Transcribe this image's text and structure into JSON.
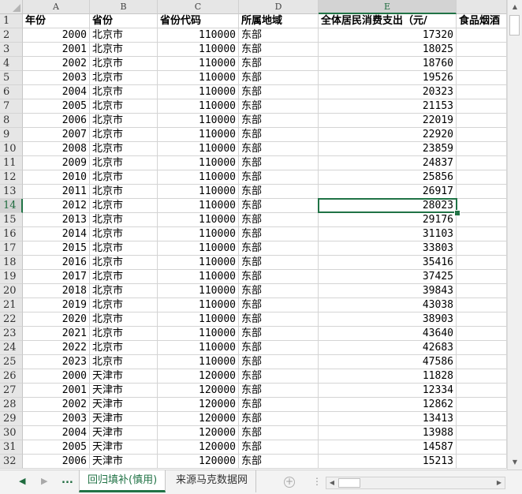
{
  "columns": [
    "A",
    "B",
    "C",
    "D",
    "E"
  ],
  "selected_column": "E",
  "selected_row": 14,
  "header_row": [
    "年份",
    "省份",
    "省份代码",
    "所属地域",
    "全体居民消费支出（元/",
    "食品烟酒"
  ],
  "rows": [
    {
      "n": "2",
      "year": "2000",
      "prov": "北京市",
      "code": "110000",
      "region": "东部",
      "value": "17320"
    },
    {
      "n": "3",
      "year": "2001",
      "prov": "北京市",
      "code": "110000",
      "region": "东部",
      "value": "18025"
    },
    {
      "n": "4",
      "year": "2002",
      "prov": "北京市",
      "code": "110000",
      "region": "东部",
      "value": "18760"
    },
    {
      "n": "5",
      "year": "2003",
      "prov": "北京市",
      "code": "110000",
      "region": "东部",
      "value": "19526"
    },
    {
      "n": "6",
      "year": "2004",
      "prov": "北京市",
      "code": "110000",
      "region": "东部",
      "value": "20323"
    },
    {
      "n": "7",
      "year": "2005",
      "prov": "北京市",
      "code": "110000",
      "region": "东部",
      "value": "21153"
    },
    {
      "n": "8",
      "year": "2006",
      "prov": "北京市",
      "code": "110000",
      "region": "东部",
      "value": "22019"
    },
    {
      "n": "9",
      "year": "2007",
      "prov": "北京市",
      "code": "110000",
      "region": "东部",
      "value": "22920"
    },
    {
      "n": "10",
      "year": "2008",
      "prov": "北京市",
      "code": "110000",
      "region": "东部",
      "value": "23859"
    },
    {
      "n": "11",
      "year": "2009",
      "prov": "北京市",
      "code": "110000",
      "region": "东部",
      "value": "24837"
    },
    {
      "n": "12",
      "year": "2010",
      "prov": "北京市",
      "code": "110000",
      "region": "东部",
      "value": "25856"
    },
    {
      "n": "13",
      "year": "2011",
      "prov": "北京市",
      "code": "110000",
      "region": "东部",
      "value": "26917"
    },
    {
      "n": "14",
      "year": "2012",
      "prov": "北京市",
      "code": "110000",
      "region": "东部",
      "value": "28023"
    },
    {
      "n": "15",
      "year": "2013",
      "prov": "北京市",
      "code": "110000",
      "region": "东部",
      "value": "29176"
    },
    {
      "n": "16",
      "year": "2014",
      "prov": "北京市",
      "code": "110000",
      "region": "东部",
      "value": "31103"
    },
    {
      "n": "17",
      "year": "2015",
      "prov": "北京市",
      "code": "110000",
      "region": "东部",
      "value": "33803"
    },
    {
      "n": "18",
      "year": "2016",
      "prov": "北京市",
      "code": "110000",
      "region": "东部",
      "value": "35416"
    },
    {
      "n": "19",
      "year": "2017",
      "prov": "北京市",
      "code": "110000",
      "region": "东部",
      "value": "37425"
    },
    {
      "n": "20",
      "year": "2018",
      "prov": "北京市",
      "code": "110000",
      "region": "东部",
      "value": "39843"
    },
    {
      "n": "21",
      "year": "2019",
      "prov": "北京市",
      "code": "110000",
      "region": "东部",
      "value": "43038"
    },
    {
      "n": "22",
      "year": "2020",
      "prov": "北京市",
      "code": "110000",
      "region": "东部",
      "value": "38903"
    },
    {
      "n": "23",
      "year": "2021",
      "prov": "北京市",
      "code": "110000",
      "region": "东部",
      "value": "43640"
    },
    {
      "n": "24",
      "year": "2022",
      "prov": "北京市",
      "code": "110000",
      "region": "东部",
      "value": "42683"
    },
    {
      "n": "25",
      "year": "2023",
      "prov": "北京市",
      "code": "110000",
      "region": "东部",
      "value": "47586"
    },
    {
      "n": "26",
      "year": "2000",
      "prov": "天津市",
      "code": "120000",
      "region": "东部",
      "value": "11828"
    },
    {
      "n": "27",
      "year": "2001",
      "prov": "天津市",
      "code": "120000",
      "region": "东部",
      "value": "12334"
    },
    {
      "n": "28",
      "year": "2002",
      "prov": "天津市",
      "code": "120000",
      "region": "东部",
      "value": "12862"
    },
    {
      "n": "29",
      "year": "2003",
      "prov": "天津市",
      "code": "120000",
      "region": "东部",
      "value": "13413"
    },
    {
      "n": "30",
      "year": "2004",
      "prov": "天津市",
      "code": "120000",
      "region": "东部",
      "value": "13988"
    },
    {
      "n": "31",
      "year": "2005",
      "prov": "天津市",
      "code": "120000",
      "region": "东部",
      "value": "14587"
    },
    {
      "n": "32",
      "year": "2006",
      "prov": "天津市",
      "code": "120000",
      "region": "东部",
      "value": "15213"
    }
  ],
  "sheet_tabs": {
    "ellipsis": "...",
    "active": "回归填补(慎用)",
    "other": "来源马克数据网"
  },
  "icons": {
    "nav_prev": "triangle-left-icon",
    "nav_next": "triangle-right-icon",
    "add_sheet": "plus-circle-icon",
    "split": "vertical-dots-icon"
  },
  "colors": {
    "accent": "#217346"
  }
}
